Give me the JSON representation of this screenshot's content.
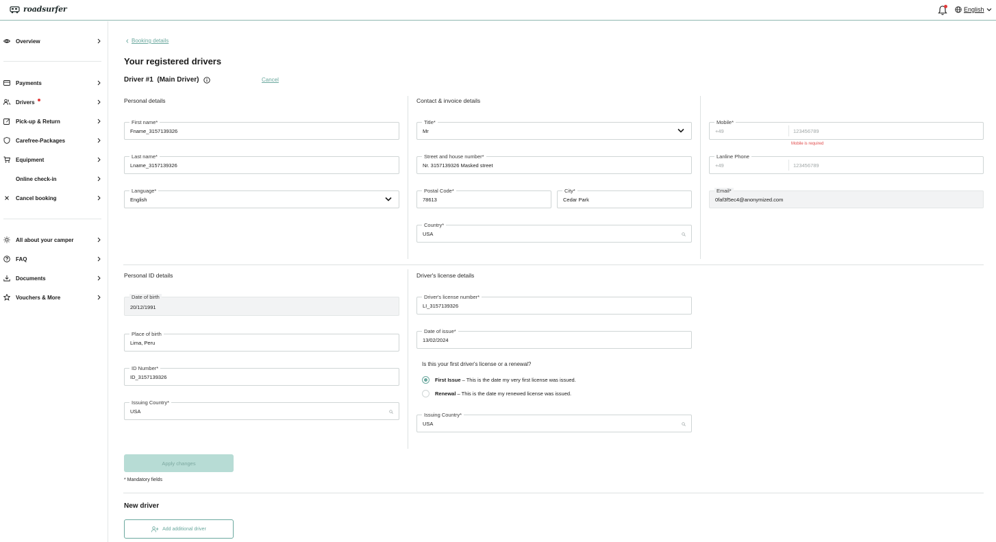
{
  "app": {
    "logo_text": "roadsurfer"
  },
  "header": {
    "language": "English"
  },
  "sidebar": {
    "items": [
      {
        "label": "Overview"
      },
      {
        "label": "Payments"
      },
      {
        "label": "Drivers"
      },
      {
        "label": "Pick-up & Return"
      },
      {
        "label": "Carefree-Packages"
      },
      {
        "label": "Equipment"
      },
      {
        "label": "Online check-in"
      },
      {
        "label": "Cancel booking"
      },
      {
        "label": "All about your camper"
      },
      {
        "label": "FAQ"
      },
      {
        "label": "Documents"
      },
      {
        "label": "Vouchers & More"
      }
    ]
  },
  "main": {
    "breadcrumb": "Booking details",
    "page_title": "Your registered drivers",
    "driver_title": "Driver #1  (Main Driver)",
    "cancel_label": "Cancel",
    "sections": {
      "personal": "Personal details",
      "contact": "Contact & invoice details",
      "personal_id": "Personal ID details",
      "license": "Driver's license details"
    },
    "fields": {
      "first_name": {
        "label": "First name*",
        "value": "Fname_3157139326"
      },
      "last_name": {
        "label": "Last name*",
        "value": "Lname_3157139326"
      },
      "language": {
        "label": "Language*",
        "value": "English"
      },
      "title": {
        "label": "Title*",
        "value": "Mr"
      },
      "street": {
        "label": "Street and house number*",
        "value": "Nr. 3157139326 Masked street"
      },
      "postal": {
        "label": "Postal Code*",
        "value": "78613"
      },
      "city": {
        "label": "City*",
        "value": "Cedar Park"
      },
      "country": {
        "label": "Country*",
        "value": "USA"
      },
      "mobile": {
        "label": "Mobile*",
        "prefix": "+49",
        "placeholder": "123456789",
        "error": "Mobile is required"
      },
      "landline": {
        "label": "Lanline Phone",
        "prefix": "+49",
        "placeholder": "123456789"
      },
      "email": {
        "label": "Email*",
        "value": "0faf3f5ec4@anonymized.com"
      },
      "dob": {
        "label": "Date of birth",
        "value": "20/12/1991"
      },
      "pob": {
        "label": "Place of birth",
        "value": "Lima, Peru"
      },
      "id_number": {
        "label": "ID Number*",
        "value": "ID_3157139326"
      },
      "issuing_country_id": {
        "label": "Issuing Country*",
        "value": "USA"
      },
      "license_number": {
        "label": "Driver's license number*",
        "value": "LI_3157139326"
      },
      "date_issue": {
        "label": "Date of issue*",
        "value": "13/02/2024"
      },
      "issuing_country_license": {
        "label": "Issuing Country*",
        "value": "USA"
      }
    },
    "license_question": "Is this your first driver's license or a renewal?",
    "radio_first": {
      "bold": "First Issue",
      "rest": " – This is the date my very first license was issued."
    },
    "radio_renewal": {
      "bold": "Renewal",
      "rest": " – This is the date my renewed license was issued."
    },
    "apply_label": "Apply changes",
    "mandatory_note": "* Mandatory fields",
    "new_driver_title": "New driver",
    "add_driver_label": "Add additional driver"
  },
  "colors": {
    "accent": "#6aa89e",
    "error": "#e04a4a",
    "disabled_bg": "#f2f3f4"
  }
}
